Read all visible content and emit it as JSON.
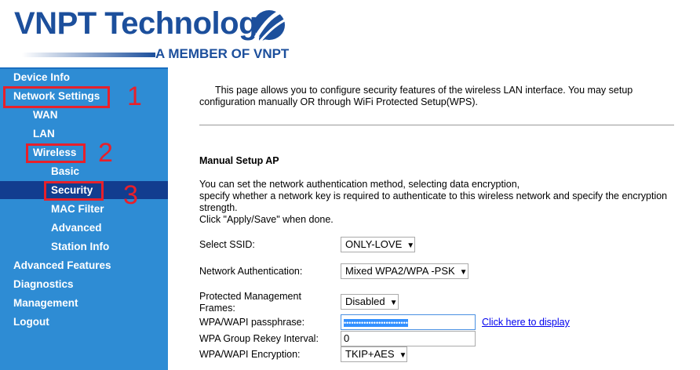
{
  "header": {
    "logo_text": "VNPT Technology",
    "logo_tagline": "A MEMBER OF VNPT"
  },
  "sidebar": {
    "items": [
      {
        "label": "Device Info"
      },
      {
        "label": "Network Settings"
      },
      {
        "label": "WAN"
      },
      {
        "label": "LAN"
      },
      {
        "label": "Wireless"
      },
      {
        "label": "Basic"
      },
      {
        "label": "Security"
      },
      {
        "label": "MAC Filter"
      },
      {
        "label": "Advanced"
      },
      {
        "label": "Station Info"
      },
      {
        "label": "Advanced Features"
      },
      {
        "label": "Diagnostics"
      },
      {
        "label": "Management"
      },
      {
        "label": "Logout"
      }
    ]
  },
  "annotations": [
    "1",
    "2",
    "3"
  ],
  "main": {
    "intro": "This page allows you to configure security features of the wireless LAN interface. You may setup configuration manually OR through WiFi Protected Setup(WPS).",
    "section_title": "Manual Setup AP",
    "desc_lines": [
      "You can set the network authentication method, selecting data encryption,",
      "specify whether a network key is required to authenticate to this wireless network and specify the encryption strength.",
      "Click \"Apply/Save\" when done."
    ],
    "ssid_label": "Select SSID:",
    "ssid_value": "ONLY-LOVE",
    "auth_label": "Network Authentication:",
    "auth_value": "Mixed WPA2/WPA -PSK",
    "pmf_label": "Protected Management Frames:",
    "pmf_value": "Disabled",
    "pass_label": "WPA/WAPI passphrase:",
    "pass_value": "••••••••••••••••••••••••••",
    "display_link": "Click here to display",
    "rekey_label": "WPA Group Rekey Interval:",
    "rekey_value": "0",
    "enc_label": "WPA/WAPI Encryption:",
    "enc_value": "TKIP+AES"
  },
  "colors": {
    "sidebar": "#2e8cd4",
    "selected": "#123d8f",
    "annotation": "#e8202a",
    "brand": "#1c4f9c"
  }
}
